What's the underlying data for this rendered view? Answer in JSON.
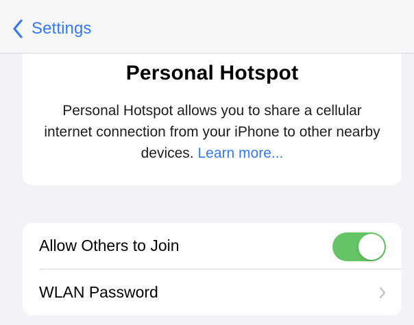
{
  "nav": {
    "back_label": "Settings",
    "back_icon": "chevron-left-icon"
  },
  "info": {
    "title": "Personal Hotspot",
    "description": "Personal Hotspot allows you to share a cellular internet connection from your iPhone to other nearby devices.",
    "learn_more": "Learn more..."
  },
  "settings": {
    "allow_others": {
      "label": "Allow Others to Join",
      "enabled": true
    },
    "wlan_password": {
      "label": "WLAN Password",
      "icon": "chevron-right-icon"
    }
  },
  "colors": {
    "accent": "#3478f6",
    "toggle_on": "#65c466",
    "background": "#f2f2f7",
    "card": "#ffffff"
  }
}
